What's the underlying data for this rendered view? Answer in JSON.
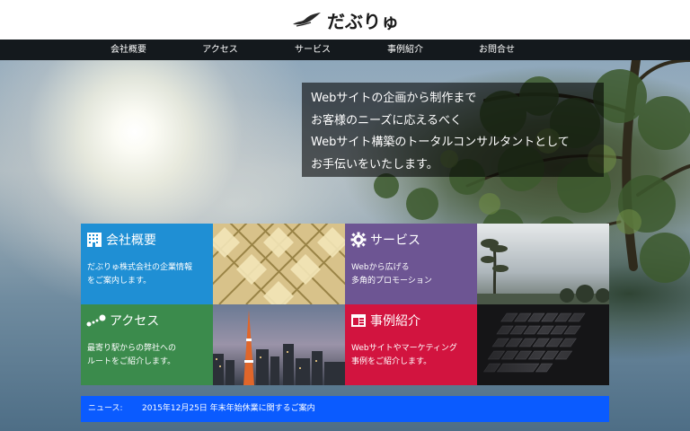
{
  "header": {
    "logo_text": "だぶりゅ"
  },
  "nav": {
    "items": [
      {
        "label": "会社概要"
      },
      {
        "label": "アクセス"
      },
      {
        "label": "サービス"
      },
      {
        "label": "事例紹介"
      },
      {
        "label": "お問合せ"
      }
    ]
  },
  "intro": {
    "lines": [
      "Webサイトの企画から制作まで",
      "お客様のニーズに応えるべく",
      "Webサイト構築のトータルコンサルタントとして",
      "お手伝いをいたします。"
    ]
  },
  "tiles": {
    "about": {
      "title": "会社概要",
      "icon": "building-icon",
      "desc": [
        "だぶりゅ株式会社の企業情報",
        "をご案内します。"
      ],
      "color": "#1f8fd4"
    },
    "service": {
      "title": "サービス",
      "icon": "gear-icon",
      "desc": [
        "Webから広げる",
        "多角的プロモーション"
      ],
      "color": "#6d5593"
    },
    "access": {
      "title": "アクセス",
      "icon": "route-dots-icon",
      "desc": [
        "最寄り駅からの弊社への",
        "ルートをご紹介します。"
      ],
      "color": "#3b8b4c"
    },
    "works": {
      "title": "事例紹介",
      "icon": "browser-window-icon",
      "desc": [
        "Webサイトやマーケティング",
        "事例をご紹介します。"
      ],
      "color": "#d2143f"
    }
  },
  "news": {
    "label": "ニュース:",
    "item": "2015年12月25日 年末年始休業に関するご案内",
    "color": "#0a5bff"
  }
}
